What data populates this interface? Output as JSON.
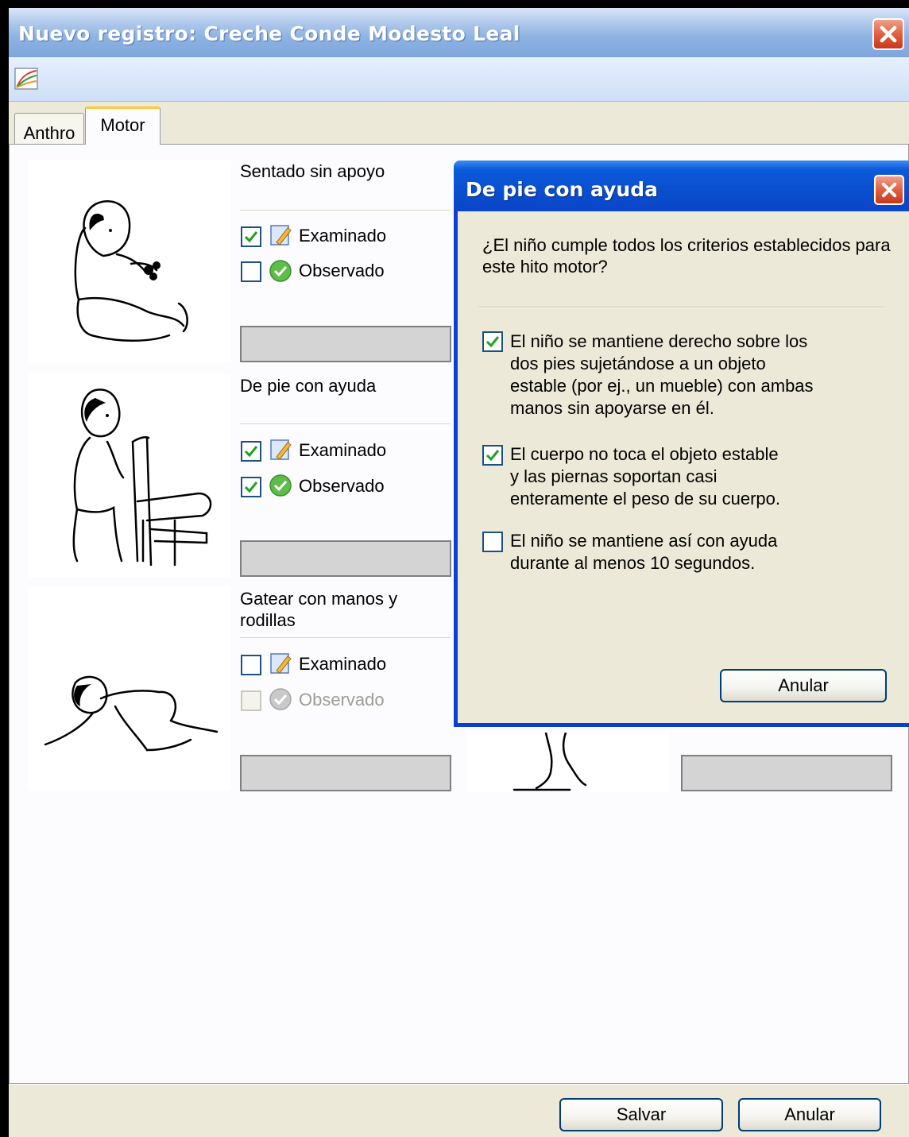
{
  "window": {
    "title": "Nuevo registro: Creche Conde Modesto Leal",
    "close_icon": "close-icon",
    "toolbar_icon": "chart-icon"
  },
  "tabs": [
    {
      "label": "Anthro",
      "active": false
    },
    {
      "label": "Motor",
      "active": true
    }
  ],
  "milestones": [
    {
      "title": "Sentado sin apoyo",
      "examinado_label": "Examinado",
      "examinado_checked": true,
      "observado_label": "Observado",
      "observado_checked": false,
      "observado_enabled": true,
      "image_icon": "baby-sitting-image"
    },
    {
      "title": "De pie con ayuda",
      "examinado_label": "Examinado",
      "examinado_checked": true,
      "observado_label": "Observado",
      "observado_checked": true,
      "observado_enabled": true,
      "image_icon": "baby-standing-image"
    },
    {
      "title": "Gatear con manos y rodillas",
      "examinado_label": "Examinado",
      "examinado_checked": false,
      "observado_label": "Observado",
      "observado_checked": false,
      "observado_enabled": false,
      "image_icon": "baby-crawling-image"
    }
  ],
  "icons": {
    "examinado": "pencil-note-icon",
    "observado": "check-circle-icon"
  },
  "buttons": {
    "save": "Salvar",
    "cancel": "Anular"
  },
  "dialog": {
    "title": "De pie con ayuda",
    "question": "¿El niño cumple todos los criterios establecidos para este hito motor?",
    "criteria": [
      {
        "lines": [
          "El niño se mantiene derecho sobre los",
          "dos pies sujetándose a un objeto",
          "estable (por ej., un mueble) con ambas",
          "manos sin apoyarse en él."
        ],
        "checked": true
      },
      {
        "lines": [
          "El cuerpo no toca el objeto estable",
          "y las piernas soportan casi",
          "enteramente el peso de su cuerpo."
        ],
        "checked": true
      },
      {
        "lines": [
          "El niño se mantiene así con ayuda",
          "durante al menos 10 segundos."
        ],
        "checked": false
      }
    ],
    "cancel_label": "Anular"
  }
}
